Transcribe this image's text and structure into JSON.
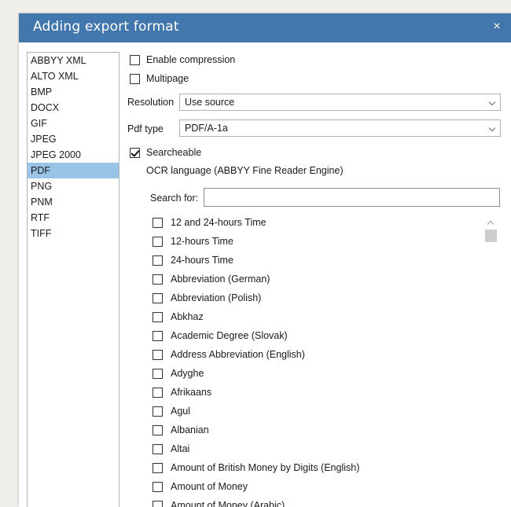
{
  "dialog": {
    "title": "Adding export format",
    "close_label": "×"
  },
  "formats": {
    "items": [
      "ABBYY XML",
      "ALTO XML",
      "BMP",
      "DOCX",
      "GIF",
      "JPEG",
      "JPEG 2000",
      "PDF",
      "PNG",
      "PNM",
      "RTF",
      "TIFF"
    ],
    "selected": "PDF"
  },
  "options": {
    "enable_compression": {
      "label": "Enable compression",
      "checked": false
    },
    "multipage": {
      "label": "Multipage",
      "checked": false
    },
    "resolution": {
      "label": "Resolution",
      "value": "Use source"
    },
    "pdf_type": {
      "label": "Pdf type",
      "value": "PDF/A-1a"
    },
    "searcheable": {
      "label": "Searcheable",
      "checked": true
    },
    "ocr_language_heading": "OCR language (ABBYY Fine Reader Engine)",
    "search": {
      "label": "Search for:",
      "value": "",
      "placeholder": ""
    }
  },
  "languages": [
    {
      "name": "12 and 24-hours Time",
      "checked": false
    },
    {
      "name": "12-hours Time",
      "checked": false
    },
    {
      "name": "24-hours Time",
      "checked": false
    },
    {
      "name": "Abbreviation (German)",
      "checked": false
    },
    {
      "name": "Abbreviation (Polish)",
      "checked": false
    },
    {
      "name": "Abkhaz",
      "checked": false
    },
    {
      "name": "Academic Degree (Slovak)",
      "checked": false
    },
    {
      "name": "Address Abbreviation (English)",
      "checked": false
    },
    {
      "name": "Adyghe",
      "checked": false
    },
    {
      "name": "Afrikaans",
      "checked": false
    },
    {
      "name": "Agul",
      "checked": false
    },
    {
      "name": "Albanian",
      "checked": false
    },
    {
      "name": "Altai",
      "checked": false
    },
    {
      "name": "Amount of British Money by Digits (English)",
      "checked": false
    },
    {
      "name": "Amount of Money",
      "checked": false
    },
    {
      "name": "Amount of Money (Arabic)",
      "checked": false
    }
  ],
  "colors": {
    "title_bar": "#4277ae",
    "selection": "#99c4e5",
    "background": "#f1efe9"
  }
}
